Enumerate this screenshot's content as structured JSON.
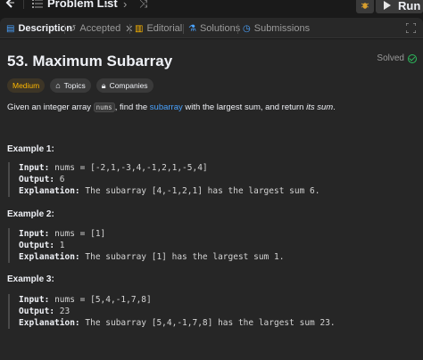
{
  "topbar": {
    "problem_list_label": "Problem List",
    "run_label": "Run"
  },
  "tabs": [
    {
      "label": "Description",
      "icon": "document-icon",
      "active": true
    },
    {
      "label": "Accepted",
      "icon": "history-icon",
      "active": false
    },
    {
      "label": "Editorial",
      "icon": "book-icon",
      "active": false
    },
    {
      "label": "Solutions",
      "icon": "flask-icon",
      "active": false
    },
    {
      "label": "Submissions",
      "icon": "clock-icon",
      "active": false
    }
  ],
  "problem": {
    "title": "53. Maximum Subarray",
    "status": "Solved",
    "difficulty": "Medium",
    "topics_label": "Topics",
    "companies_label": "Companies",
    "desc_part1": "Given an integer array ",
    "desc_code": "nums",
    "desc_part2": ", find the ",
    "desc_link": "subarray",
    "desc_part3": " with the largest sum, and return ",
    "desc_em": "its sum",
    "desc_end": "."
  },
  "examples": [
    {
      "title": "Example 1:",
      "input_label": "Input:",
      "input": "nums = [-2,1,-3,4,-1,2,1,-5,4]",
      "output_label": "Output:",
      "output": "6",
      "explanation_label": "Explanation:",
      "explanation": "The subarray [4,-1,2,1] has the largest sum 6."
    },
    {
      "title": "Example 2:",
      "input_label": "Input:",
      "input": "nums = [1]",
      "output_label": "Output:",
      "output": "1",
      "explanation_label": "Explanation:",
      "explanation": "The subarray [1] has the largest sum 1."
    },
    {
      "title": "Example 3:",
      "input_label": "Input:",
      "input": "nums = [5,4,-1,7,8]",
      "output_label": "Output:",
      "output": "23",
      "explanation_label": "Explanation:",
      "explanation": "The subarray [5,4,-1,7,8] has the largest sum 23."
    }
  ],
  "colors": {
    "background": "#1a1a1a",
    "panel": "#262626",
    "medium": "#ffb800",
    "solved": "#2cbb5d",
    "link": "#4aa3ff"
  }
}
